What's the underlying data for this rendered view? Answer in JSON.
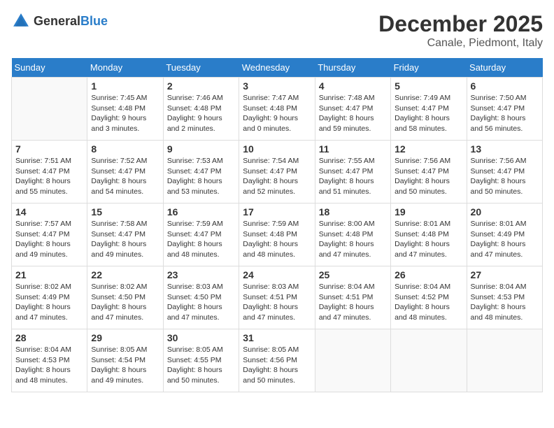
{
  "header": {
    "logo_general": "General",
    "logo_blue": "Blue",
    "month_title": "December 2025",
    "location": "Canale, Piedmont, Italy"
  },
  "weekdays": [
    "Sunday",
    "Monday",
    "Tuesday",
    "Wednesday",
    "Thursday",
    "Friday",
    "Saturday"
  ],
  "weeks": [
    [
      {
        "day": "",
        "sunrise": "",
        "sunset": "",
        "daylight": ""
      },
      {
        "day": "1",
        "sunrise": "Sunrise: 7:45 AM",
        "sunset": "Sunset: 4:48 PM",
        "daylight": "Daylight: 9 hours and 3 minutes."
      },
      {
        "day": "2",
        "sunrise": "Sunrise: 7:46 AM",
        "sunset": "Sunset: 4:48 PM",
        "daylight": "Daylight: 9 hours and 2 minutes."
      },
      {
        "day": "3",
        "sunrise": "Sunrise: 7:47 AM",
        "sunset": "Sunset: 4:48 PM",
        "daylight": "Daylight: 9 hours and 0 minutes."
      },
      {
        "day": "4",
        "sunrise": "Sunrise: 7:48 AM",
        "sunset": "Sunset: 4:47 PM",
        "daylight": "Daylight: 8 hours and 59 minutes."
      },
      {
        "day": "5",
        "sunrise": "Sunrise: 7:49 AM",
        "sunset": "Sunset: 4:47 PM",
        "daylight": "Daylight: 8 hours and 58 minutes."
      },
      {
        "day": "6",
        "sunrise": "Sunrise: 7:50 AM",
        "sunset": "Sunset: 4:47 PM",
        "daylight": "Daylight: 8 hours and 56 minutes."
      }
    ],
    [
      {
        "day": "7",
        "sunrise": "Sunrise: 7:51 AM",
        "sunset": "Sunset: 4:47 PM",
        "daylight": "Daylight: 8 hours and 55 minutes."
      },
      {
        "day": "8",
        "sunrise": "Sunrise: 7:52 AM",
        "sunset": "Sunset: 4:47 PM",
        "daylight": "Daylight: 8 hours and 54 minutes."
      },
      {
        "day": "9",
        "sunrise": "Sunrise: 7:53 AM",
        "sunset": "Sunset: 4:47 PM",
        "daylight": "Daylight: 8 hours and 53 minutes."
      },
      {
        "day": "10",
        "sunrise": "Sunrise: 7:54 AM",
        "sunset": "Sunset: 4:47 PM",
        "daylight": "Daylight: 8 hours and 52 minutes."
      },
      {
        "day": "11",
        "sunrise": "Sunrise: 7:55 AM",
        "sunset": "Sunset: 4:47 PM",
        "daylight": "Daylight: 8 hours and 51 minutes."
      },
      {
        "day": "12",
        "sunrise": "Sunrise: 7:56 AM",
        "sunset": "Sunset: 4:47 PM",
        "daylight": "Daylight: 8 hours and 50 minutes."
      },
      {
        "day": "13",
        "sunrise": "Sunrise: 7:56 AM",
        "sunset": "Sunset: 4:47 PM",
        "daylight": "Daylight: 8 hours and 50 minutes."
      }
    ],
    [
      {
        "day": "14",
        "sunrise": "Sunrise: 7:57 AM",
        "sunset": "Sunset: 4:47 PM",
        "daylight": "Daylight: 8 hours and 49 minutes."
      },
      {
        "day": "15",
        "sunrise": "Sunrise: 7:58 AM",
        "sunset": "Sunset: 4:47 PM",
        "daylight": "Daylight: 8 hours and 49 minutes."
      },
      {
        "day": "16",
        "sunrise": "Sunrise: 7:59 AM",
        "sunset": "Sunset: 4:47 PM",
        "daylight": "Daylight: 8 hours and 48 minutes."
      },
      {
        "day": "17",
        "sunrise": "Sunrise: 7:59 AM",
        "sunset": "Sunset: 4:48 PM",
        "daylight": "Daylight: 8 hours and 48 minutes."
      },
      {
        "day": "18",
        "sunrise": "Sunrise: 8:00 AM",
        "sunset": "Sunset: 4:48 PM",
        "daylight": "Daylight: 8 hours and 47 minutes."
      },
      {
        "day": "19",
        "sunrise": "Sunrise: 8:01 AM",
        "sunset": "Sunset: 4:48 PM",
        "daylight": "Daylight: 8 hours and 47 minutes."
      },
      {
        "day": "20",
        "sunrise": "Sunrise: 8:01 AM",
        "sunset": "Sunset: 4:49 PM",
        "daylight": "Daylight: 8 hours and 47 minutes."
      }
    ],
    [
      {
        "day": "21",
        "sunrise": "Sunrise: 8:02 AM",
        "sunset": "Sunset: 4:49 PM",
        "daylight": "Daylight: 8 hours and 47 minutes."
      },
      {
        "day": "22",
        "sunrise": "Sunrise: 8:02 AM",
        "sunset": "Sunset: 4:50 PM",
        "daylight": "Daylight: 8 hours and 47 minutes."
      },
      {
        "day": "23",
        "sunrise": "Sunrise: 8:03 AM",
        "sunset": "Sunset: 4:50 PM",
        "daylight": "Daylight: 8 hours and 47 minutes."
      },
      {
        "day": "24",
        "sunrise": "Sunrise: 8:03 AM",
        "sunset": "Sunset: 4:51 PM",
        "daylight": "Daylight: 8 hours and 47 minutes."
      },
      {
        "day": "25",
        "sunrise": "Sunrise: 8:04 AM",
        "sunset": "Sunset: 4:51 PM",
        "daylight": "Daylight: 8 hours and 47 minutes."
      },
      {
        "day": "26",
        "sunrise": "Sunrise: 8:04 AM",
        "sunset": "Sunset: 4:52 PM",
        "daylight": "Daylight: 8 hours and 48 minutes."
      },
      {
        "day": "27",
        "sunrise": "Sunrise: 8:04 AM",
        "sunset": "Sunset: 4:53 PM",
        "daylight": "Daylight: 8 hours and 48 minutes."
      }
    ],
    [
      {
        "day": "28",
        "sunrise": "Sunrise: 8:04 AM",
        "sunset": "Sunset: 4:53 PM",
        "daylight": "Daylight: 8 hours and 48 minutes."
      },
      {
        "day": "29",
        "sunrise": "Sunrise: 8:05 AM",
        "sunset": "Sunset: 4:54 PM",
        "daylight": "Daylight: 8 hours and 49 minutes."
      },
      {
        "day": "30",
        "sunrise": "Sunrise: 8:05 AM",
        "sunset": "Sunset: 4:55 PM",
        "daylight": "Daylight: 8 hours and 50 minutes."
      },
      {
        "day": "31",
        "sunrise": "Sunrise: 8:05 AM",
        "sunset": "Sunset: 4:56 PM",
        "daylight": "Daylight: 8 hours and 50 minutes."
      },
      {
        "day": "",
        "sunrise": "",
        "sunset": "",
        "daylight": ""
      },
      {
        "day": "",
        "sunrise": "",
        "sunset": "",
        "daylight": ""
      },
      {
        "day": "",
        "sunrise": "",
        "sunset": "",
        "daylight": ""
      }
    ]
  ]
}
